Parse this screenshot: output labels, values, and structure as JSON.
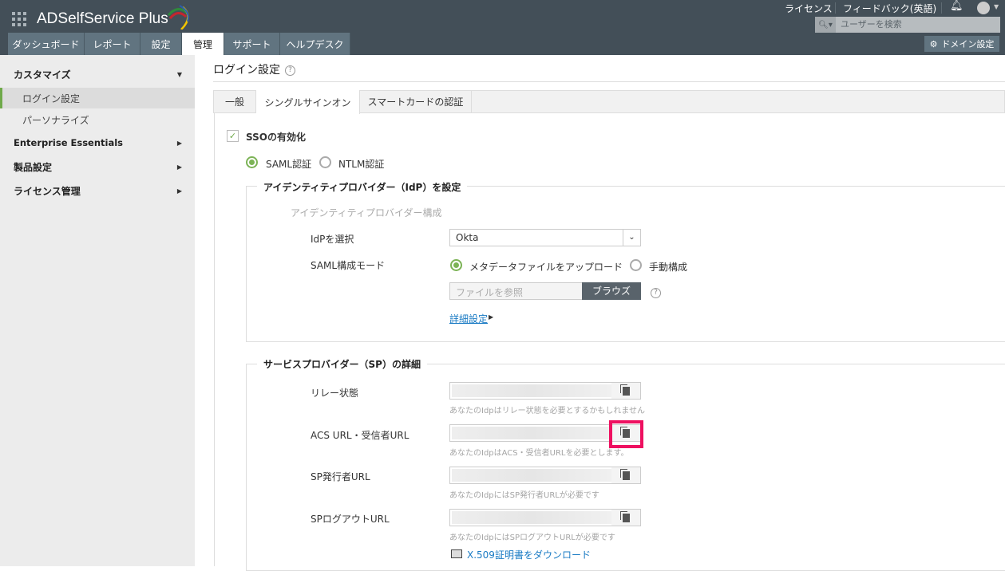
{
  "header": {
    "app_name": "ADSelfService Plus",
    "links": [
      "ライセンス",
      "フィードバック(英語)"
    ],
    "search_placeholder": "ユーザーを検索",
    "domain_button": "ドメイン設定"
  },
  "nav_tabs": [
    "ダッシュボード",
    "レポート",
    "設定",
    "管理",
    "サポート",
    "ヘルプデスク"
  ],
  "sidebar": {
    "customize": "カスタマイズ",
    "login_settings": "ログイン設定",
    "personalize": "パーソナライズ",
    "enterprise": "Enterprise Essentials",
    "product_settings": "製品設定",
    "license_mgmt": "ライセンス管理"
  },
  "page": {
    "title": "ログイン設定",
    "help": "?",
    "tabs": [
      "一般",
      "シングルサインオン",
      "スマートカードの認証"
    ]
  },
  "sso": {
    "enable_label": "SSOの有効化",
    "check": "✓",
    "saml": "SAML認証",
    "ntlm": "NTLM認証"
  },
  "idp": {
    "legend": "アイデンティティプロバイダー（IdP）を設定",
    "subtitle": "アイデンティティプロバイダー構成",
    "select_label": "IdPを選択",
    "select_value": "Okta",
    "mode_label": "SAML構成モード",
    "mode_upload": "メタデータファイルをアップロード",
    "mode_manual": "手動構成",
    "file_placeholder": "ファイルを参照",
    "browse": "ブラウズ",
    "advanced": "詳細設定"
  },
  "sp": {
    "legend": "サービスプロバイダー（SP）の詳細",
    "rows": [
      {
        "label": "リレー状態",
        "hint": "あなたのIdpはリレー状態を必要とするかもしれません"
      },
      {
        "label": "ACS URL・受信者URL",
        "hint": "あなたのIdpはACS・受信者URLを必要とします。"
      },
      {
        "label": "SP発行者URL",
        "hint": "あなたのIdpにはSP発行者URLが必要です"
      },
      {
        "label": "SPログアウトURL",
        "hint": "あなたのIdpにはSPログアウトURLが必要です"
      }
    ],
    "download": "X.509証明書をダウンロード"
  },
  "colors": {
    "header": "#434f58",
    "tab": "#617480",
    "accent": "#7cb356",
    "highlight": "#ee1060",
    "link": "#1a7bc4"
  }
}
